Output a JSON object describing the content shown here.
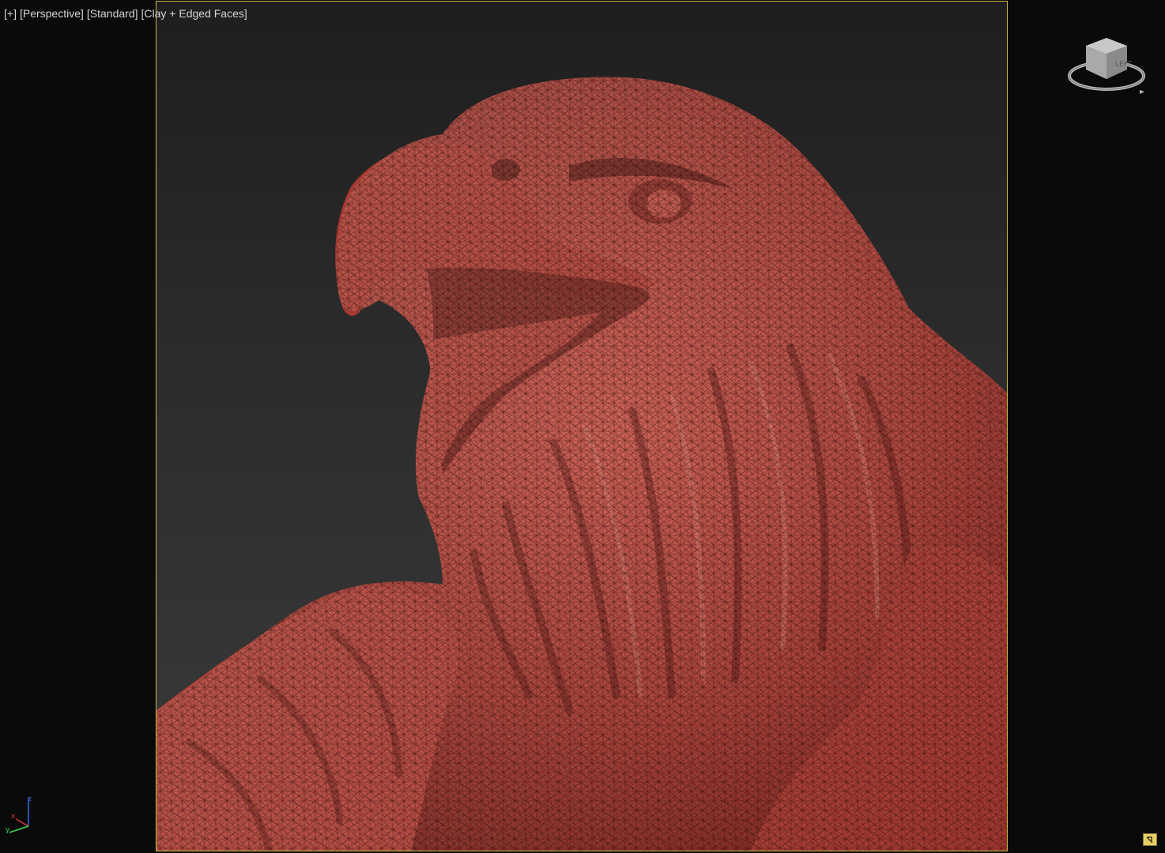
{
  "viewport": {
    "label_parts": [
      "[+]",
      "[Perspective]",
      "[Standard]",
      "[Clay + Edged Faces]"
    ],
    "background_top": "#1e1e1e",
    "background_bottom": "#3b3b3b",
    "safe_frame_color": "#c9b84a",
    "model_color": "#a83c34",
    "model_highlight": "#d7877c",
    "wire_color": "#2a0806"
  },
  "view_cube": {
    "icon": "view-cube-icon",
    "face_front": "LEFT"
  },
  "axis_tripod": {
    "icon": "axis-tripod-icon",
    "x": "x",
    "y": "y",
    "z": "z"
  },
  "corner_button": {
    "icon": "maximize-toggle-icon"
  }
}
